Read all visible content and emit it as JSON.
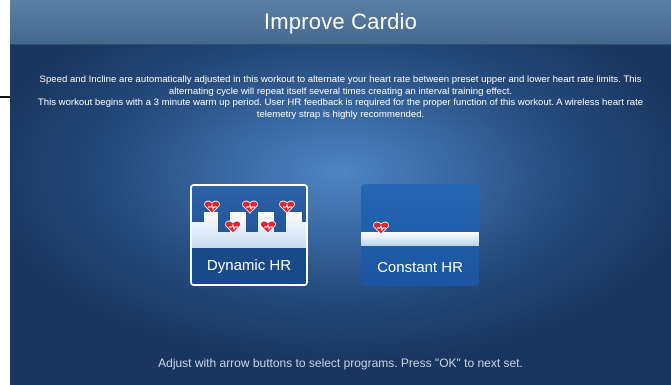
{
  "header": {
    "title": "Improve Cardio"
  },
  "description": {
    "paragraph1": "Speed and Incline are automatically adjusted in this workout to alternate your heart rate between preset upper and lower heart rate limits. This alternating cycle will repeat itself several times creating an interval training effect.",
    "paragraph2": "This workout begins with a 3 minute warm up period. User HR feedback is required for the proper function of this workout. A wireless heart rate  telemetry strap is highly recommended."
  },
  "programs": [
    {
      "label": "Dynamic HR",
      "icon": "heart-interval-icon",
      "selected": true
    },
    {
      "label": "Constant HR",
      "icon": "heart-steady-icon",
      "selected": false
    }
  ],
  "footer": {
    "hint": "Adjust with arrow buttons to select programs. Press \"OK\" to next set."
  },
  "colors": {
    "heart": "#e0232f",
    "accent_blue": "#1d57a3",
    "highlight_border": "#ffffff"
  }
}
